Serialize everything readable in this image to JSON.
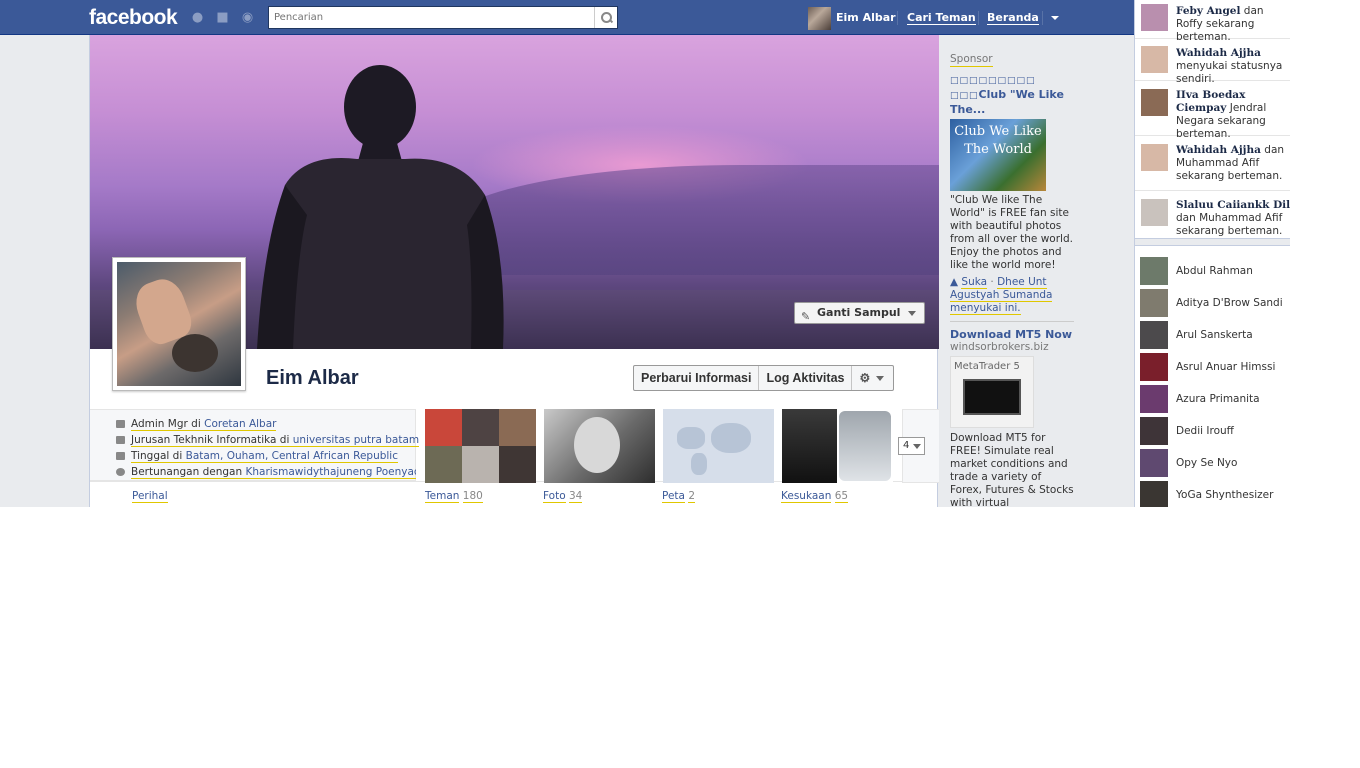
{
  "topbar": {
    "logo": "facebook",
    "search_placeholder": "Pencarian",
    "user_name": "Eim Albar",
    "find_friends": "Cari Teman",
    "home": "Beranda"
  },
  "cover": {
    "change_cover": "Ganti Sampul"
  },
  "profile": {
    "name": "Eim Albar",
    "update_info": "Perbarui Informasi",
    "activity_log": "Log Aktivitas"
  },
  "info": [
    {
      "pre": "Admin Mgr di ",
      "link": "Coretan Albar"
    },
    {
      "pre": "Jurusan Tekhnik Informatika di ",
      "link": "universitas putra batam"
    },
    {
      "pre": "Tinggal di ",
      "link": "Batam, Ouham, Central African Republic"
    },
    {
      "pre": "Bertunangan dengan ",
      "link": "Kharismawidythajuneng Poenyacita"
    }
  ],
  "about_label": "Perihal",
  "tiles": [
    {
      "label": "Teman",
      "count": "180"
    },
    {
      "label": "Foto",
      "count": "34"
    },
    {
      "label": "Peta",
      "count": "2"
    },
    {
      "label": "Kesukaan",
      "count": "65"
    }
  ],
  "more_count": "4",
  "ads": {
    "header": "Sponsor",
    "ad1": {
      "title": "Club \"We Like The...",
      "image_text": "Club We Like The World",
      "body": "\"Club We like The World\" is FREE fan site with beautiful photos from all over the world. Enjoy the photos and like the world more!",
      "like": "Suka",
      "social": "Dhee Unt Agustyah Sumanda menyukai ini."
    },
    "ad2": {
      "title": "Download MT5 Now",
      "domain": "windsorbrokers.biz",
      "image_text": "MetaTrader 5",
      "body": "Download MT5 for FREE! Simulate real market conditions and trade a variety of Forex, Futures & Stocks with virtual"
    }
  },
  "ticker": [
    {
      "name": "Feby Angel",
      "rest": " dan Roffy sekarang berteman.",
      "color": "#b98fae"
    },
    {
      "name": "Wahidah Ajjha",
      "rest": " menyukai statusnya sendiri.",
      "color": "#d7b8a6"
    },
    {
      "name": "IIva Boedax Ciempay",
      "rest": " Jendral Negara sekarang berteman.",
      "color": "#8a6a55"
    },
    {
      "name": "Wahidah Ajjha",
      "rest": " dan Muhammad Afif sekarang berteman.",
      "color": "#d7b8a6"
    },
    {
      "name": "Slaluu Caiiankk Dil",
      "rest": " dan Muhammad Afif sekarang berteman.",
      "color": "#c9c2bd"
    }
  ],
  "chat": [
    {
      "name": "Abdul Rahman",
      "color": "#6d7a6a"
    },
    {
      "name": "Aditya D'Brow Sandi",
      "color": "#7f7b6e"
    },
    {
      "name": "Arul Sanskerta",
      "color": "#4c4a4c"
    },
    {
      "name": "Asrul Anuar Himssi",
      "color": "#7a1f2b"
    },
    {
      "name": "Azura Primanita",
      "color": "#6b3b6e"
    },
    {
      "name": "Dedii Irouff",
      "color": "#3e3438"
    },
    {
      "name": "Opy Se Nyo",
      "color": "#5f4970"
    },
    {
      "name": "YoGa Shynthesizer",
      "color": "#3a3632"
    }
  ]
}
